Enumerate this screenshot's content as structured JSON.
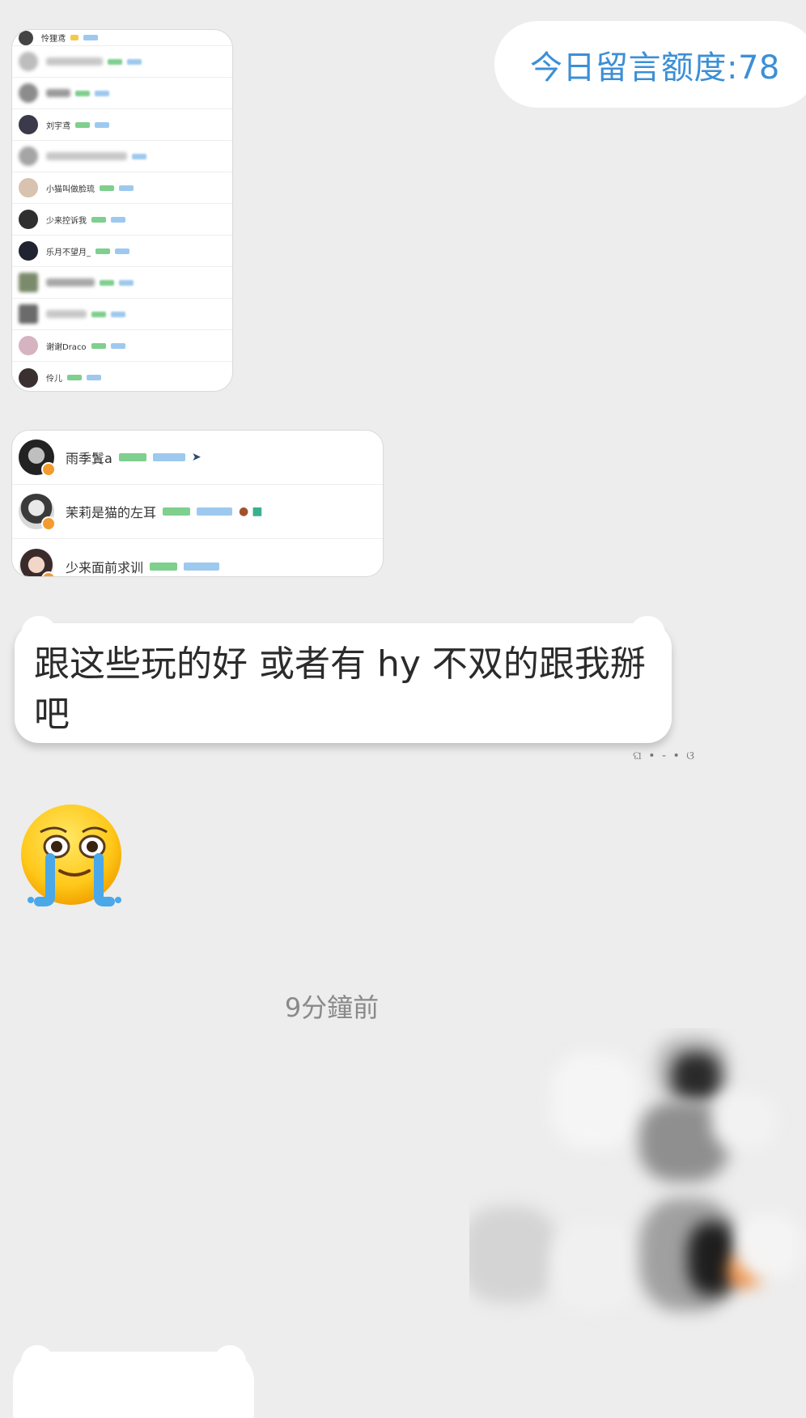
{
  "quota": {
    "label": "今日留言额度:78"
  },
  "member_list_1": {
    "rows": [
      {
        "name": "怜狸鸢",
        "blurred": false
      },
      {
        "name": "",
        "blurred": true
      },
      {
        "name": "",
        "blurred": true
      },
      {
        "name": "刘宇鸢",
        "blurred": false
      },
      {
        "name": "",
        "blurred": true
      },
      {
        "name": "小猫叫做脸琉",
        "blurred": false
      },
      {
        "name": "少来控诉我",
        "blurred": false
      },
      {
        "name": "乐月不望月_",
        "blurred": false
      },
      {
        "name": "",
        "blurred": true
      },
      {
        "name": "",
        "blurred": true
      },
      {
        "name": "谢谢Draco",
        "blurred": false
      },
      {
        "name": "伶儿",
        "blurred": false
      }
    ]
  },
  "member_list_2": {
    "rows": [
      {
        "name": "雨季鬒a"
      },
      {
        "name": "茉莉是猫的左耳"
      },
      {
        "name": "少来面前求训"
      }
    ]
  },
  "message": {
    "text": "跟这些玩的好 或者有 hy 不双的跟我掰吧"
  },
  "timestamp": "9分鐘前",
  "colors": {
    "background": "#ededed",
    "quota_text": "#3c8fd6",
    "bubble": "#ffffff",
    "timestamp": "#8a8a8a"
  },
  "icons": {
    "emoji": "crying-face-emoji"
  }
}
